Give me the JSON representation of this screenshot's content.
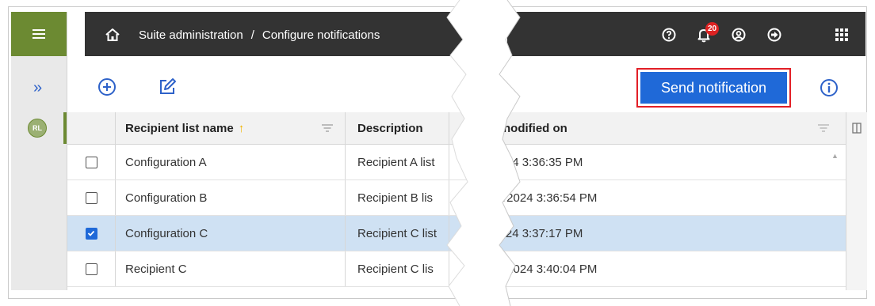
{
  "header": {
    "breadcrumb_root": "Suite administration",
    "breadcrumb_separator": "/",
    "breadcrumb_current": "Configure notifications",
    "notification_count": "20"
  },
  "icons": {
    "menu": "hamburger-icon",
    "home": "home-icon",
    "help": "help-icon",
    "notifications": "bell-icon",
    "user": "user-icon",
    "signout": "sign-out-icon",
    "apps": "apps-grid-icon",
    "expand": "double-chevron-right-icon",
    "add": "add-circle-icon",
    "edit": "edit-icon",
    "info": "info-icon",
    "filter": "filter-icon",
    "columns": "columns-icon"
  },
  "sidebar": {
    "badge": "RL"
  },
  "toolbar": {
    "send_label": "Send notification"
  },
  "table": {
    "columns": {
      "name": "Recipient list name",
      "description": "Description",
      "modified": "nodified on"
    },
    "rows": [
      {
        "checked": false,
        "name": "Configuration A",
        "description": "Recipient A list",
        "modified": "'24 3:36:35 PM"
      },
      {
        "checked": false,
        "name": "Configuration B",
        "description": "Recipient B lis",
        "modified": "‎/2024 3:36:54 PM"
      },
      {
        "checked": true,
        "name": "Configuration C",
        "description": "Recipient C list",
        "modified": "'24 3:37:17 PM"
      },
      {
        "checked": false,
        "name": "Recipient C",
        "description": "Recipient C lis",
        "modified": "‎/2024 3:40:04 PM"
      }
    ]
  },
  "colors": {
    "brand_green": "#6c8a32",
    "topbar": "#333333",
    "primary_blue": "#1f69d8",
    "highlight_red": "#e21f26",
    "selected_row": "#cfe1f3",
    "sort_arrow": "#f1b400"
  }
}
